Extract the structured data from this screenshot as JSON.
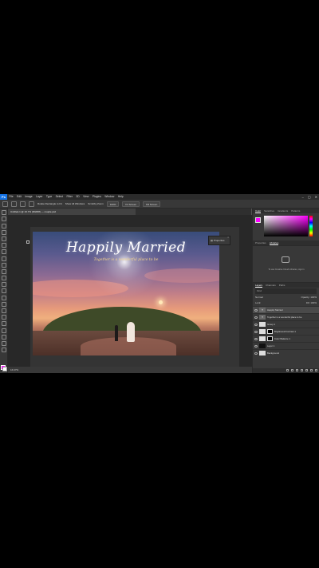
{
  "app": {
    "logo": "Ps",
    "accent": "#1473e6"
  },
  "menu": [
    "File",
    "Edit",
    "Image",
    "Layer",
    "Type",
    "Select",
    "Filter",
    "3D",
    "View",
    "Plugins",
    "Window",
    "Help"
  ],
  "window_controls": [
    "–",
    "▢",
    "✕"
  ],
  "options_bar": {
    "home_icon": "home-icon",
    "buttons": [
      "Rotate Rectangle to Fit",
      "Show All Windows",
      "Scrubby Zoom",
      "100%",
      "Fit Screen",
      "Fill Screen"
    ]
  },
  "document": {
    "tab_title": "Untitled-1 @ 16.7% (RGB/8) — couple.psd",
    "status": "16.67%"
  },
  "canvas_image": {
    "title": "Happily Married",
    "subtitle": "Together is a wonderful place to be"
  },
  "properties_chip": {
    "label": "Properties",
    "close": "×"
  },
  "colors": {
    "foreground": "#ff00ff",
    "background": "#ffffff"
  },
  "right_panels": {
    "color_tabs": [
      "Color",
      "Swatches",
      "Gradients",
      "Patterns"
    ],
    "library_tabs": [
      "Properties",
      "Libraries"
    ],
    "library_message": "To use Creative Cloud Libraries, sign in",
    "layers_tabs": [
      "Layers",
      "Channels",
      "Paths"
    ],
    "layers_search": "Kind",
    "blend_mode": "Normal",
    "opacity": "Opacity: 100%",
    "lock_label": "Lock:",
    "fill": "Fill: 100%",
    "layers": [
      {
        "name": "Happily Married",
        "type": "text",
        "selected": true
      },
      {
        "name": "Together is a wonderful place to be",
        "type": "text",
        "selected": false
      },
      {
        "name": "Group 1",
        "type": "group",
        "selected": false
      },
      {
        "name": "Brightness/Contrast 1",
        "type": "adjust",
        "selected": false
      },
      {
        "name": "Color Balance 1",
        "type": "adjust",
        "selected": false
      },
      {
        "name": "Layer 1",
        "type": "pixel",
        "selected": false
      },
      {
        "name": "Background",
        "type": "pixel",
        "selected": false
      }
    ]
  }
}
